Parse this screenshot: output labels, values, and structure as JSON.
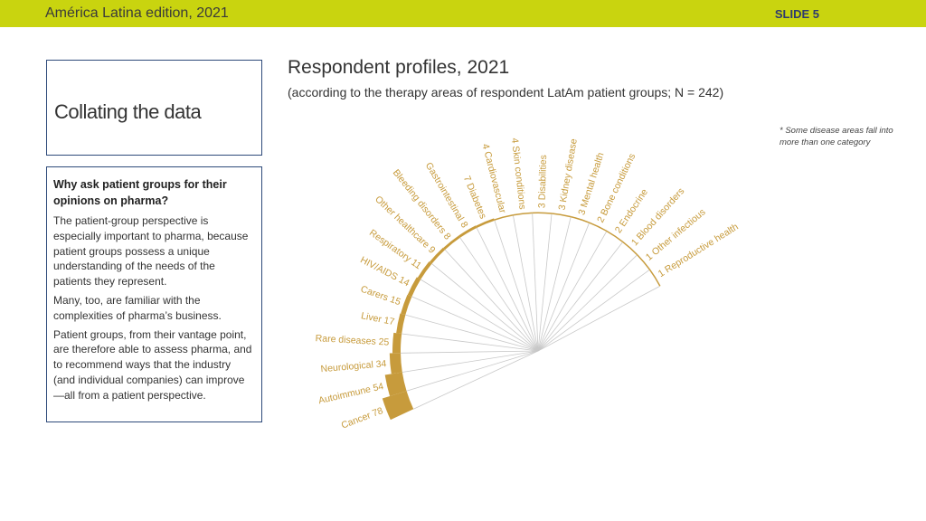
{
  "header": {
    "edition": "América Latina edition, 2021",
    "slide": "SLIDE 5"
  },
  "box1": {
    "title": "Collating the data"
  },
  "box2": {
    "heading": "Why ask patient groups for their opinions on pharma?",
    "p1": "The patient-group perspective is especially important to pharma, because patient groups possess a unique understanding of the needs of the patients they represent.",
    "p2": "Many, too, are familiar with the complexities of pharma’s business.",
    "p3": "Patient groups, from their vantage point, are therefore able to assess pharma, and to recommend ways that the industry (and individual companies) can improve—all from a patient perspective."
  },
  "chart_title": "Respondent profiles, 2021",
  "chart_subtitle": "(according to the therapy areas of respondent LatAm patient groups; N = 242)",
  "note": "* Some disease areas fall into more than one category",
  "colors": {
    "accent": "#c9d40f",
    "bar": "#c79b3c",
    "border": "#2e4a7a"
  },
  "chart_data": {
    "type": "bar",
    "layout": "radial-fan",
    "categories": [
      "Cancer",
      "Autoimmune",
      "Neurological",
      "Rare diseases",
      "Liver",
      "Carers",
      "HIV/AIDS",
      "Respiratory",
      "Other healthcare",
      "Bleeding disorders",
      "Gastrointestinal",
      "Diabetes",
      "Cardiovascular",
      "Skin conditions",
      "Disabilities",
      "Kidney disease",
      "Mental health",
      "Bone conditions",
      "Endocrine",
      "Blood disorders",
      "Other infectious",
      "Reproductive health"
    ],
    "values": [
      78,
      54,
      34,
      25,
      17,
      15,
      14,
      11,
      9,
      8,
      8,
      7,
      4,
      4,
      3,
      3,
      3,
      2,
      2,
      1,
      1,
      1
    ],
    "labels": [
      "Cancer 78",
      "Autoimmune 54",
      "Neurological 34",
      "Rare diseases 25",
      "Liver 17",
      "Carers 15",
      "HIV/AIDS 14",
      "Respiratory 11",
      "Other healthcare 9",
      "Bleeding disorders 8",
      "Gastrointestinal 8",
      "7 Diabetes",
      "4 Cardiovascular",
      "4 Skin conditions",
      "3 Disabilities",
      "3 Kidney disease",
      "3 Mental health",
      "2 Bone conditions",
      "2 Endocrine",
      "1 Blood disorders",
      "1 Other infectious",
      "1 Reproductive health"
    ]
  }
}
